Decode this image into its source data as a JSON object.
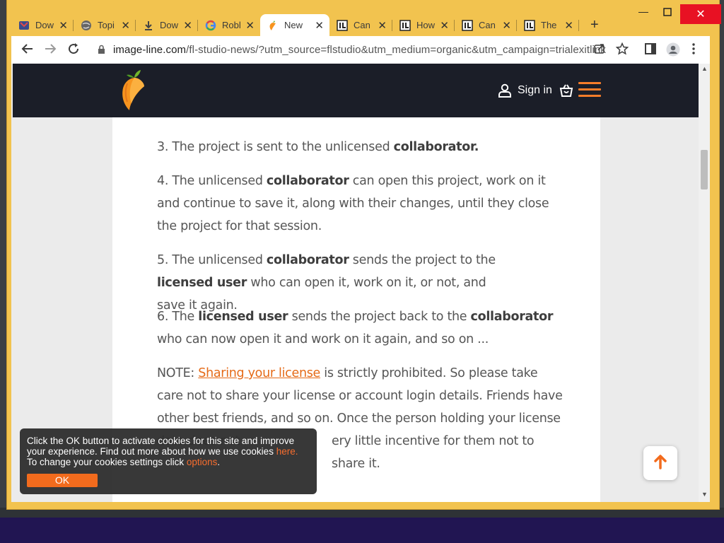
{
  "browser": {
    "tabs": [
      {
        "label": "Dow",
        "icon": "mail-icon"
      },
      {
        "label": "Topi",
        "icon": "globe-icon"
      },
      {
        "label": "Dow",
        "icon": "download-icon"
      },
      {
        "label": "Robl",
        "icon": "google-icon"
      },
      {
        "label": "New",
        "icon": "fl-studio-icon",
        "active": true
      },
      {
        "label": "Can",
        "icon": "image-line-icon"
      },
      {
        "label": "How",
        "icon": "image-line-icon"
      },
      {
        "label": "Can",
        "icon": "image-line-icon"
      },
      {
        "label": "The",
        "icon": "image-line-icon"
      }
    ],
    "url_host": "image-line.com",
    "url_path": "/fl-studio-news/?utm_source=flstudio&utm_medium=organic&utm_campaign=trialexitlink"
  },
  "site_header": {
    "sign_in_label": "Sign in"
  },
  "article": {
    "p3_text": "3. The project is sent to the unlicensed ",
    "p3_bold": "collaborator.",
    "p4_a": "4. The unlicensed ",
    "p4_bold": "collaborator",
    "p4_b": " can open this project, work on it and continue to save it, along with their changes, until they close the project for that session.",
    "p5_a": "5. The unlicensed ",
    "p5_bold1": "collaborator",
    "p5_b": " sends the project to the ",
    "p5_bold2": "licensed user",
    "p5_c": " who can open it, work on it, or not, and save it again.",
    "p6_a": "6. The ",
    "p6_bold1": "licensed user",
    "p6_b": " sends the project back to the ",
    "p6_bold2": "collaborator",
    "p6_c": " who can now open it and work on it again, and so on ...",
    "note_a": "NOTE: ",
    "note_link": "Sharing your license",
    "note_b": " is strictly prohibited. So please take care not to share your license or account login details. Friends have other best friends, and so on. Once the person holding your license data does not",
    "note_c": "ery little incentive for them not to share it."
  },
  "cookie_banner": {
    "line1": "Click the OK button to activate cookies for this site and improve your experience. Find out more about how we use cookies ",
    "here_link": "here.",
    "line2": "To change your cookies settings click ",
    "options_link": "options",
    "ok_label": "OK"
  },
  "colors": {
    "accent": "#f26b1d",
    "header_bg": "#1b1e28",
    "browser_frame": "#f2c34f"
  }
}
